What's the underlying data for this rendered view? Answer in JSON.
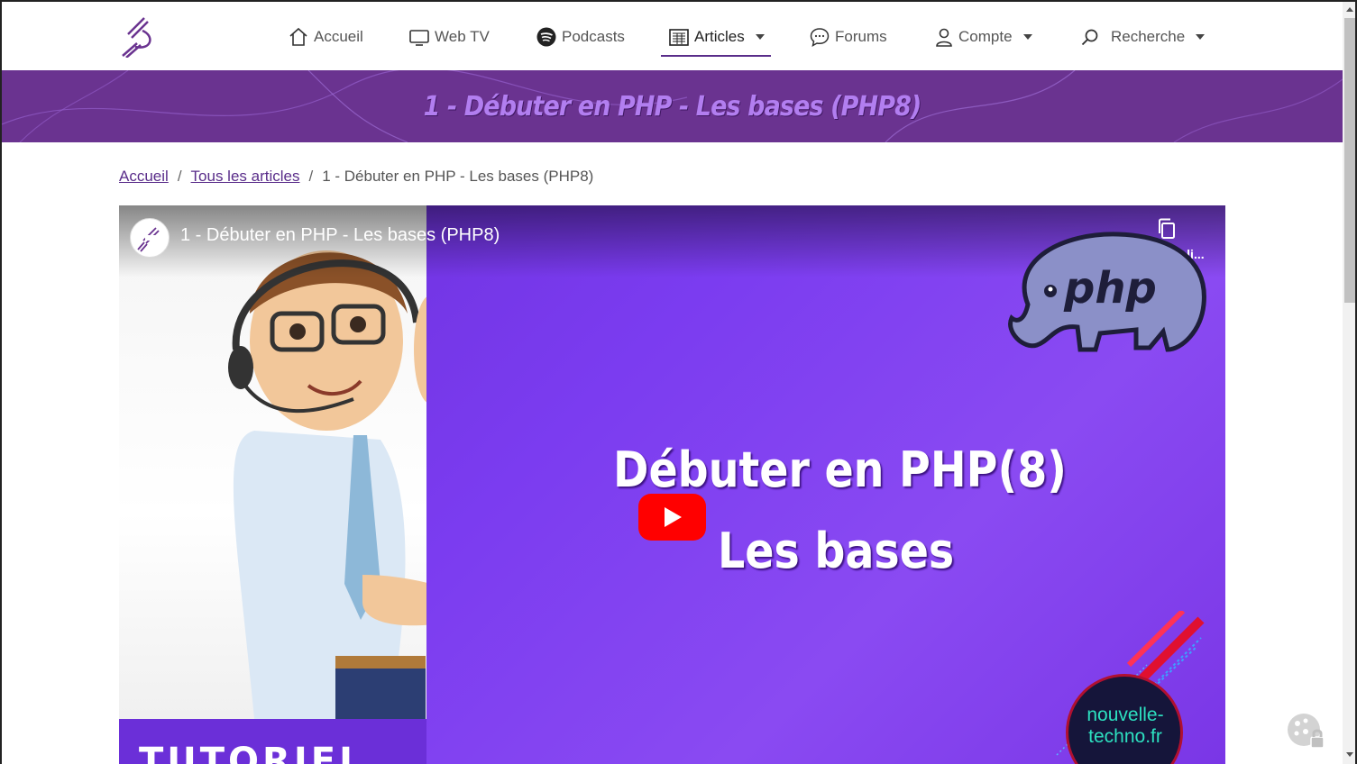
{
  "nav": {
    "items": [
      {
        "label": "Accueil",
        "icon": "house-icon"
      },
      {
        "label": "Web TV",
        "icon": "tv-icon"
      },
      {
        "label": "Podcasts",
        "icon": "spotify-icon"
      },
      {
        "label": "Articles",
        "icon": "newspaper-icon",
        "active": true,
        "dropdown": true
      },
      {
        "label": "Forums",
        "icon": "chat-icon"
      },
      {
        "label": "Compte",
        "icon": "user-icon",
        "dropdown": true
      },
      {
        "label": "Recherche",
        "icon": "search-icon",
        "dropdown": true
      }
    ]
  },
  "banner": {
    "title": "1 - Débuter en PHP - Les bases (PHP8)"
  },
  "breadcrumb": {
    "home": "Accueil",
    "sep1": "/",
    "all_articles": "Tous les articles",
    "sep2": "/",
    "current": "1 - Débuter en PHP - Les bases (PHP8)"
  },
  "video": {
    "title": "1 - Débuter en PHP - Les bases (PHP8)",
    "copy_link": "Copier le li...",
    "headline_line1": "Débuter en PHP(8)",
    "headline_line2": "Les bases",
    "php_logo_text": "php",
    "tutoriel_text": "TUTORIEL",
    "brand_line1": "nouvelle-",
    "brand_line2": "techno.fr"
  },
  "colors": {
    "accent": "#5a2d8a",
    "banner": "#6a3390",
    "video_bg": "#7b3cf0",
    "youtube_red": "#ff0000"
  }
}
